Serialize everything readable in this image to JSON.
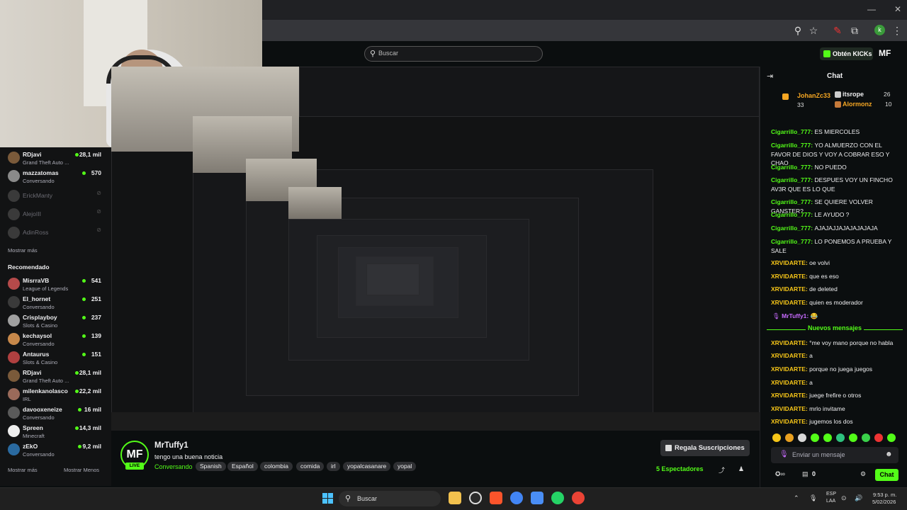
{
  "search": {
    "placeholder": "Buscar"
  },
  "header": {
    "kicks_label": "Obtén KICKs",
    "logo": "MF"
  },
  "sidebar": {
    "following": [
      {
        "name": "RDjavi",
        "category": "Grand Theft Auto ...",
        "viewers": "28,1 mil",
        "live": true,
        "avatar_color": "#7a5a3a"
      },
      {
        "name": "mazzatomas",
        "category": "Conversando",
        "viewers": "570",
        "live": true,
        "avatar_color": "#8a8a8a"
      },
      {
        "name": "ErickManty",
        "category": "",
        "viewers": "",
        "live": false,
        "avatar_color": "#4a4a4a"
      },
      {
        "name": "AlejoIII",
        "category": "",
        "viewers": "",
        "live": false,
        "avatar_color": "#4a4a4a"
      },
      {
        "name": "AdinRoss",
        "category": "",
        "viewers": "",
        "live": false,
        "avatar_color": "#4a4a4a"
      }
    ],
    "show_more": "Mostrar más",
    "recommended_title": "Recomendado",
    "recommended": [
      {
        "name": "MisrraVB",
        "category": "League of Legends",
        "viewers": "541",
        "avatar_color": "#b54a4a"
      },
      {
        "name": "El_hornet",
        "category": "Conversando",
        "viewers": "251",
        "avatar_color": "#3a3a3a"
      },
      {
        "name": "Crisplayboy",
        "category": "Slots & Casino",
        "viewers": "237",
        "avatar_color": "#a0a0a0"
      },
      {
        "name": "kechaysol",
        "category": "Conversando",
        "viewers": "139",
        "avatar_color": "#c7884a"
      },
      {
        "name": "Antaurus",
        "category": "Slots & Casino",
        "viewers": "151",
        "avatar_color": "#b04040"
      },
      {
        "name": "RDjavi",
        "category": "Grand Theft Auto ...",
        "viewers": "28,1 mil",
        "avatar_color": "#7a5a3a"
      },
      {
        "name": "milenkanolasco",
        "category": "IRL",
        "viewers": "22,2 mil",
        "avatar_color": "#9a6a5a"
      },
      {
        "name": "davooxeneize",
        "category": "Conversando",
        "viewers": "16 mil",
        "avatar_color": "#5a5a5a"
      },
      {
        "name": "Spreen",
        "category": "Minecraft",
        "viewers": "14,3 mil",
        "avatar_color": "#eeeeee"
      },
      {
        "name": "zEkO",
        "category": "Conversando",
        "viewers": "9,2 mil",
        "avatar_color": "#2a6aa0"
      }
    ],
    "show_more2": "Mostrar más",
    "show_less": "Mostrar Menos"
  },
  "stream": {
    "avatar_text": "MF",
    "live_label": "LIVE",
    "name": "MrTuffy1",
    "title": "tengo una buena noticia",
    "category": "Conversando",
    "tags": [
      "Spanish",
      "Español",
      "colombia",
      "comida",
      "irl",
      "yopalcasanare",
      "yopal"
    ],
    "gift_label": "Regala Suscripciones",
    "viewers": "5 Espectadores"
  },
  "chat": {
    "title": "Chat",
    "pinned": [
      {
        "name": "JohanZc33",
        "count": "33"
      },
      {
        "name": "itsrope",
        "count": "26"
      },
      {
        "name": "Alormonz",
        "count": "10"
      }
    ],
    "messages": [
      {
        "user": "Cigarrillo_777",
        "text": "ES MIERCOLES"
      },
      {
        "user": "Cigarrillo_777",
        "text": "YO ALMUERZO CON EL FAVOR DE DIOS Y VOY A COBRAR ESO Y CHAO"
      },
      {
        "user": "Cigarrillo_777",
        "text": "NO PUEDO"
      },
      {
        "user": "Cigarrillo_777",
        "text": "DESPUES VOY UN FINCHO AV3R QUE ES LO QUE"
      },
      {
        "user": "Cigarrillo_777",
        "text": "SE QUIERE VOLVER GANSTER?"
      },
      {
        "user": "Cigarrillo_777",
        "text": "LE AYUDO ?"
      },
      {
        "user": "Cigarrillo_777",
        "text": "AJAJAJJAJAJAJAJAJA"
      },
      {
        "user": "Cigarrillo_777",
        "text": "LO PONEMOS A PRUEBA Y SALE"
      },
      {
        "user": "XRVIDARTE",
        "text": "oe volvi"
      },
      {
        "user": "XRVIDARTE",
        "text": "que es eso"
      },
      {
        "user": "XRVIDARTE",
        "text": "de deleted"
      },
      {
        "user": "XRVIDARTE",
        "text": "quien es moderador"
      },
      {
        "user": "MrTuffy1",
        "text": ""
      }
    ],
    "new_messages": "Nuevos mensajes",
    "messages2": [
      {
        "user": "XRVIDARTE",
        "text": "°me voy mano porque no habla"
      },
      {
        "user": "XRVIDARTE",
        "text": "a"
      },
      {
        "user": "XRVIDARTE",
        "text": "porque no juega juegos"
      },
      {
        "user": "XRVIDARTE",
        "text": "a"
      },
      {
        "user": "XRVIDARTE",
        "text": "juege frefire o otros"
      },
      {
        "user": "XRVIDARTE",
        "text": "mrlo invitame"
      },
      {
        "user": "XRVIDARTE",
        "text": "jugemos los dos"
      }
    ],
    "input_placeholder": "Enviar un mensaje",
    "points": "0",
    "chat_button": "Chat"
  },
  "taskbar": {
    "search": "Buscar",
    "lang1": "ESP",
    "lang2": "LAA",
    "time": "9:53 p. m.",
    "date": "5/02/2026"
  },
  "colors": {
    "accent": "#53fc18",
    "xrv": "#f5c518",
    "pinned": "#f5a623"
  }
}
